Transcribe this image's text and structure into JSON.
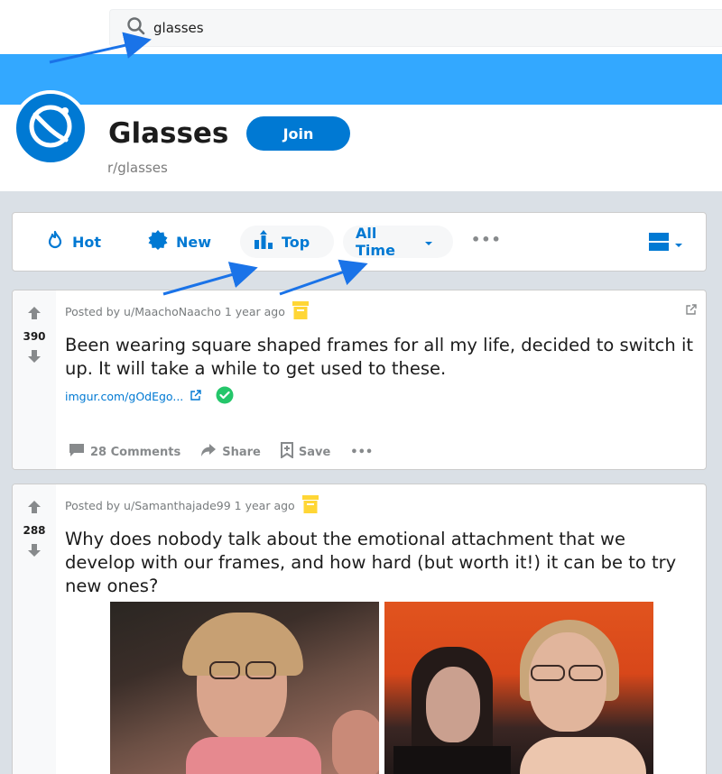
{
  "search": {
    "value": "glasses",
    "icon": "search-icon"
  },
  "subreddit": {
    "title": "Glasses",
    "name": "r/glasses",
    "join_label": "Join",
    "banner_color": "#33a8ff",
    "accent": "#0079d3"
  },
  "sort": {
    "items": [
      {
        "label": "Hot",
        "icon": "flame-icon"
      },
      {
        "label": "New",
        "icon": "badge-icon"
      },
      {
        "label": "Top",
        "icon": "top-bars-icon"
      }
    ],
    "time_label": "All Time",
    "more_label": "•••"
  },
  "posts": [
    {
      "votes": "390",
      "meta": "Posted by u/MaachoNaacho 1 year ago",
      "title": "Been wearing square shaped frames for all my life, decided to switch it up. It will take a while to get used to these.",
      "link": "imgur.com/gOdEgo...",
      "comments": "28 Comments",
      "share": "Share",
      "save": "Save",
      "more": "•••"
    },
    {
      "votes": "288",
      "meta": "Posted by u/Samanthajade99 1 year ago",
      "title": "Why does nobody talk about the emotional attachment that we develop with our frames, and how hard (but worth it!) it can be to try new ones?"
    }
  ]
}
